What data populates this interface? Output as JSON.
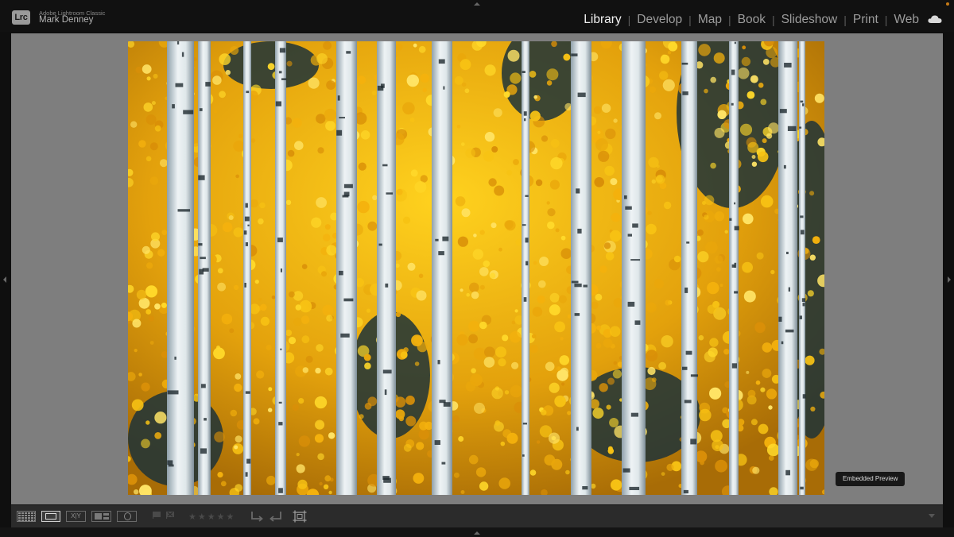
{
  "app": {
    "logo_text": "Lrc",
    "name": "Adobe Lightroom Classic",
    "user": "Mark Denney"
  },
  "modules": [
    {
      "label": "Library",
      "active": true
    },
    {
      "label": "Develop",
      "active": false
    },
    {
      "label": "Map",
      "active": false
    },
    {
      "label": "Book",
      "active": false
    },
    {
      "label": "Slideshow",
      "active": false
    },
    {
      "label": "Print",
      "active": false
    },
    {
      "label": "Web",
      "active": false
    }
  ],
  "module_separator": "|",
  "viewer": {
    "photo_alt": "Aspen trees with golden autumn foliage",
    "tooltip": "Embedded Preview"
  },
  "toolbar": {
    "compare_label": "X|Y",
    "rating": 0,
    "rating_max": 5,
    "icons": [
      "grid-view-icon",
      "loupe-view-icon",
      "compare-view-icon",
      "survey-view-icon",
      "people-view-icon",
      "flag-pick-icon",
      "flag-reject-icon",
      "star-rating-icon",
      "rotate-left-icon",
      "rotate-right-icon",
      "crop-overlay-icon"
    ]
  },
  "colors": {
    "panel_bg": "#111111",
    "viewer_bg": "#7e7e7e",
    "toolbar_bg": "#2b2b2b",
    "active_module": "#f0f0f0",
    "inactive_module": "#9c9c9c",
    "foliage": "#f2b40f",
    "accent_dot": "#c57a17"
  }
}
